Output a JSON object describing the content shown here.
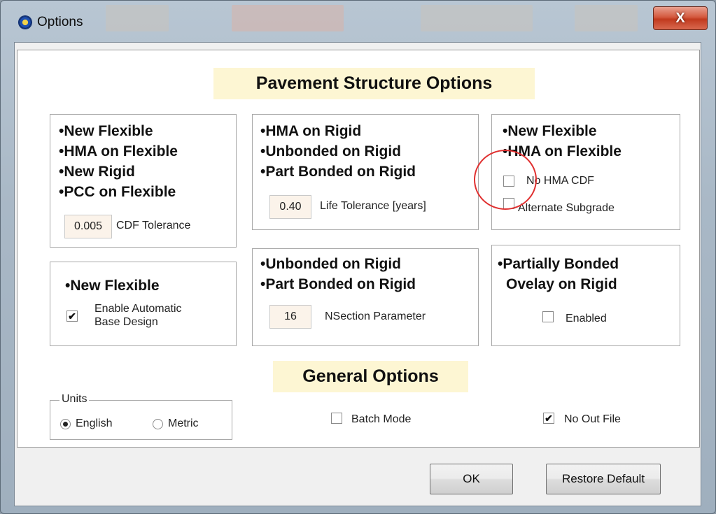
{
  "window": {
    "title": "Options",
    "close_glyph": "X"
  },
  "pavement_title": "Pavement Structure Options",
  "general_title": "General Options",
  "group_a": {
    "items": [
      "New Flexible",
      "HMA on Flexible",
      "New Rigid",
      "PCC on Flexible"
    ],
    "field_value": "0.005",
    "field_label": "CDF Tolerance"
  },
  "group_b": {
    "items": [
      "HMA on Rigid",
      "Unbonded on Rigid",
      "Part Bonded on Rigid"
    ],
    "field_value": "0.40",
    "field_label": "Life Tolerance [years]"
  },
  "group_c": {
    "items": [
      "New Flexible",
      "HMA on Flexible"
    ],
    "cb1_label": "No HMA CDF",
    "cb1_checked": false,
    "cb2_label": "Alternate Subgrade",
    "cb2_checked": false
  },
  "group_d": {
    "item": "New Flexible",
    "cb_label_1": "Enable Automatic",
    "cb_label_2": "Base Design",
    "cb_checked": true
  },
  "group_e": {
    "items": [
      "Unbonded on Rigid",
      "Part Bonded on Rigid"
    ],
    "field_value": "16",
    "field_label": "NSection Parameter"
  },
  "group_f": {
    "title_1": "Partially  Bonded",
    "title_2": "Ovelay on Rigid",
    "cb_label": "Enabled",
    "cb_checked": false
  },
  "units": {
    "legend": "Units",
    "options": [
      "English",
      "Metric"
    ],
    "selected": "English"
  },
  "batch_mode": {
    "label": "Batch Mode",
    "checked": false
  },
  "no_out_file": {
    "label": "No Out File",
    "checked": true
  },
  "buttons": {
    "ok": "OK",
    "restore": "Restore Default"
  },
  "bullet_char": "•"
}
